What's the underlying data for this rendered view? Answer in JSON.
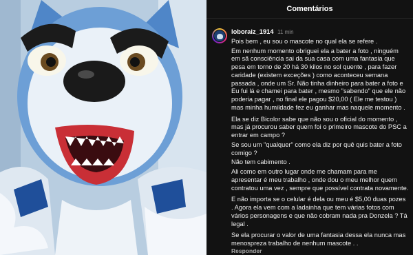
{
  "header": {
    "title": "Comentários"
  },
  "comment": {
    "username": "loboraiz_1914",
    "time": "11 min",
    "paragraphs": [
      "Pois bem , eu sou o mascote no qual ela se refere .",
      "Em nenhum momento obriguei ela a bater a foto , ninguém em sã consciência sai da sua casa com uma fantasia que pesa em torno de 20 há 30 kilos no sol quente , para fazer caridade (existem exceções ) como aconteceu semana passada , onde um Sr. Não tinha dinheiro para bater a foto e Eu fui lá e chamei para bater , mesmo \"sabendo\" que ele não poderia pagar , no final ele pagou $20,00 ( Ele me testou ) mas minha humildade fez eu ganhar mas naquele momento .",
      "Ela se diz Bicolor sabe que não sou o oficial do momento , mas já procurou saber quem foi o primeiro mascote do PSC a entrar em campo ?",
      "Se sou um \"qualquer\" como ela diz por quê quis bater a foto comigo ?",
      "Não tem cabimento .",
      "Ali como em outro lugar onde me chamam para me apresentar é meu trabalho , onde dou o meu melhor quem contratou uma vez , sempre que possível contrata novamente.",
      "E não importa se o celular é dela ou meu é $5,00 duas pozes . Agora ela vem com a ladainha que tem várias fotos com vários personagens e que não cobram nada pra Donzela ? Tá legal .",
      "Se ela procurar o valor de uma fantasia dessa ela nunca mas menospreza trabalho de nenhum mascote . ."
    ],
    "reply_label": "Responder"
  },
  "icons": {
    "avatar": "wolf-avatar-icon"
  },
  "colors": {
    "background": "#121212",
    "mascot_fur": "#eef3f8",
    "mascot_blue": "#5b8fd0",
    "mouth": "#d63a3a"
  }
}
